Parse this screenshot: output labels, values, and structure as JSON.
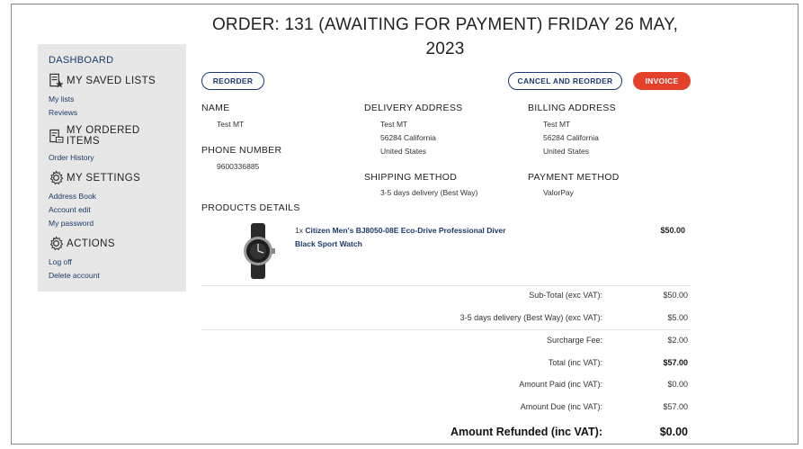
{
  "page_title": "ORDER: 131 (AWAITING FOR PAYMENT) FRIDAY 26 MAY, 2023",
  "sidebar": {
    "dashboard": "DASHBOARD",
    "saved_lists": {
      "heading": "MY SAVED LISTS",
      "icon": "saved-list-icon",
      "links": [
        "My lists",
        "Reviews"
      ]
    },
    "ordered_items": {
      "heading": "MY ORDERED ITEMS",
      "icon": "ordered-items-icon",
      "links": [
        "Order History"
      ]
    },
    "settings": {
      "heading": "MY SETTINGS",
      "icon": "gear-icon",
      "links": [
        "Address Book",
        "Account edit",
        "My password"
      ]
    },
    "actions": {
      "heading": "ACTIONS",
      "icon": "gear-icon",
      "links": [
        "Log off",
        "Delete account"
      ]
    }
  },
  "buttons": {
    "reorder": "REORDER",
    "cancel_reorder": "CANCEL AND REORDER",
    "invoice": "INVOICE"
  },
  "name": {
    "label": "NAME",
    "value": "Test MT"
  },
  "phone": {
    "label": "PHONE NUMBER",
    "value": "9600336885"
  },
  "delivery_address": {
    "label": "DELIVERY ADDRESS",
    "lines": [
      "Test MT",
      "56284 California",
      "United States"
    ]
  },
  "billing_address": {
    "label": "BILLING ADDRESS",
    "lines": [
      "Test MT",
      "56284 California",
      "United States"
    ]
  },
  "shipping_method": {
    "label": "SHIPPING METHOD",
    "value": "3-5 days delivery (Best Way)"
  },
  "payment_method": {
    "label": "PAYMENT METHOD",
    "value": "ValorPay"
  },
  "products": {
    "label": "PRODUCTS DETAILS",
    "items": [
      {
        "qty": "1x",
        "name": "Citizen Men's BJ8050-08E Eco-Drive Professional Diver Black Sport Watch",
        "price": "$50.00"
      }
    ]
  },
  "totals": [
    {
      "label": "Sub-Total (exc VAT):",
      "value": "$50.00"
    },
    {
      "label": "3-5 days delivery (Best Way) (exc VAT):",
      "value": "$5.00"
    },
    {
      "label": "Surcharge Fee:",
      "value": "$2.00"
    },
    {
      "label": "Total (inc VAT):",
      "value": "$57.00"
    },
    {
      "label": "Amount Paid (inc VAT):",
      "value": "$0.00"
    },
    {
      "label": "Amount Due (inc VAT):",
      "value": "$57.00"
    },
    {
      "label": "Amount Refunded (inc VAT):",
      "value": "$0.00"
    }
  ],
  "colors": {
    "accent_blue": "#1b3a6b",
    "invoice_red": "#e4412c",
    "sidebar_bg": "#e7e7e7"
  }
}
